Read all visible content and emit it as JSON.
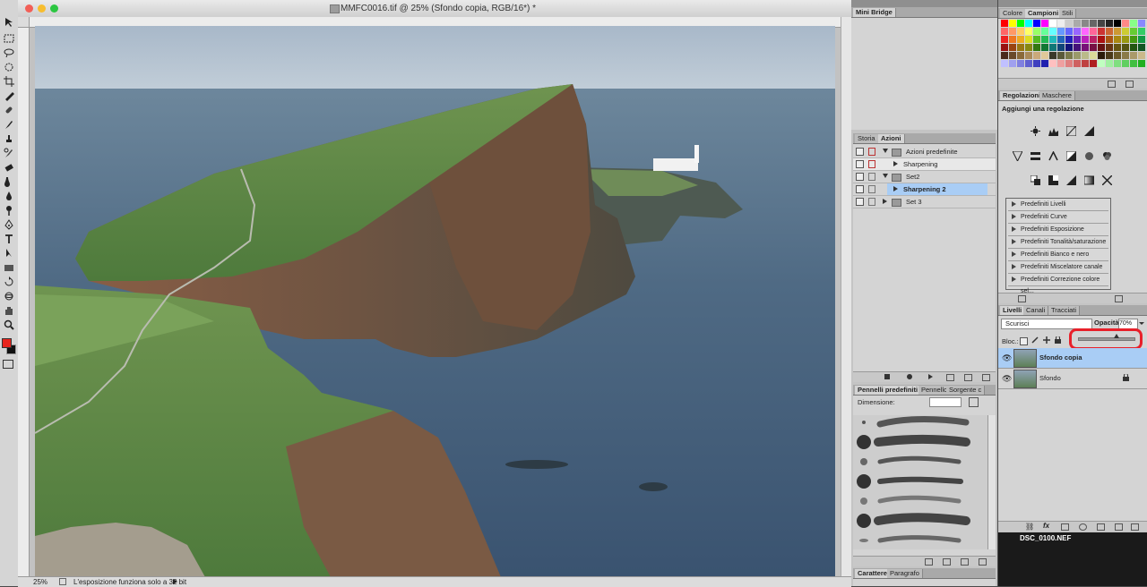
{
  "document": {
    "title": "MMFC0016.tif @ 25% (Sfondo copia, RGB/16*) *",
    "zoom": "25%",
    "status_message": "L'esposizione funziona solo a 32 bit"
  },
  "mini_bridge": {
    "tab": "Mini Bridge"
  },
  "swatches_panel": {
    "tabs": [
      "Colore",
      "Campioni",
      "Stili"
    ],
    "active_tab": "Campioni"
  },
  "adjustments_panel": {
    "tabs": [
      "Regolazioni",
      "Maschere"
    ],
    "active_tab": "Regolazioni",
    "heading": "Aggiungi una regolazione",
    "presets": [
      "Predefiniti Livelli",
      "Predefiniti Curve",
      "Predefiniti Esposizione",
      "Predefiniti Tonalità/saturazione",
      "Predefiniti Bianco e nero",
      "Predefiniti Miscelatore canale",
      "Predefiniti Correzione colore sel..."
    ]
  },
  "actions_panel": {
    "tabs": [
      "Storia",
      "Azioni"
    ],
    "active_tab": "Azioni",
    "rows": [
      {
        "label": "Azioni predefinite",
        "kind": "set",
        "expanded": true
      },
      {
        "label": "Sharpening",
        "kind": "action",
        "expanded": false
      },
      {
        "label": "Set2",
        "kind": "set",
        "expanded": true
      },
      {
        "label": "Sharpening 2",
        "kind": "action",
        "expanded": false,
        "selected": true
      },
      {
        "label": "Set 3",
        "kind": "set",
        "expanded": false
      }
    ]
  },
  "brushes_panel": {
    "tabs": [
      "Pennelli predefiniti",
      "Pennello",
      "Sorgente c"
    ],
    "active_tab": "Pennelli predefiniti",
    "size_label": "Dimensione:"
  },
  "character_panel": {
    "tabs": [
      "Carattere",
      "Paragrafo"
    ],
    "active_tab": "Carattere"
  },
  "layers_panel": {
    "tabs": [
      "Livelli",
      "Canali",
      "Tracciati"
    ],
    "active_tab": "Livelli",
    "blend_mode": "Scurisci",
    "opacity_label": "Opacità:",
    "opacity_value": "70%",
    "opacity_fraction": 0.7,
    "lock_label": "Bloc.:",
    "layers": [
      {
        "name": "Sfondo copia",
        "selected": true,
        "locked": false
      },
      {
        "name": "Sfondo",
        "selected": false,
        "locked": true
      }
    ]
  },
  "background_file": {
    "label": "DSC_0100.NEF"
  },
  "colors": {
    "foreground": "#e8251d",
    "background": "#111111",
    "highlight_ring": "#e8202a",
    "selection": "#a9cdf5"
  }
}
